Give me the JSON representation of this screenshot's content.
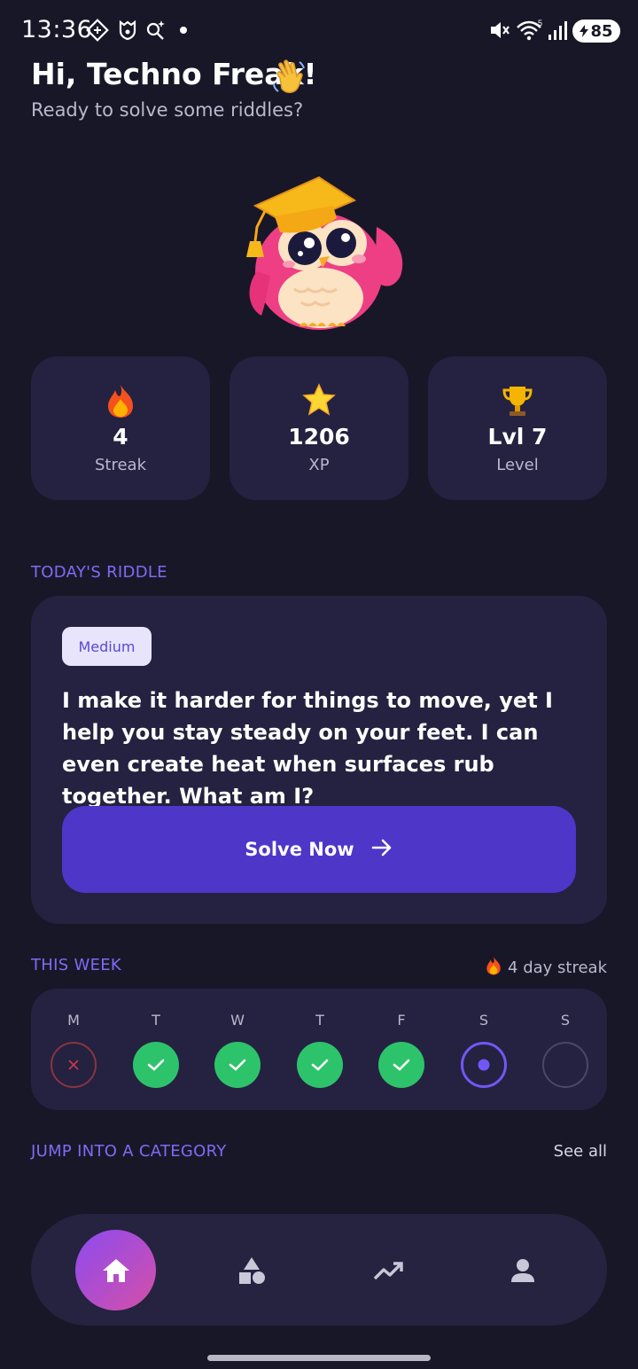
{
  "status_bar": {
    "time": "13:36",
    "battery": "85",
    "icons": [
      "gps-icon",
      "shield-icon",
      "search-sparkle-icon",
      "dot-icon",
      "mute-icon",
      "wifi-icon",
      "signal-icon",
      "battery-icon"
    ]
  },
  "header": {
    "greeting": "Hi, Techno Freak!",
    "subtitle": "Ready to solve some riddles?"
  },
  "stats": [
    {
      "icon": "fire-icon",
      "value": "4",
      "label": "Streak"
    },
    {
      "icon": "star-icon",
      "value": "1206",
      "label": "XP"
    },
    {
      "icon": "trophy-icon",
      "value": "Lvl 7",
      "label": "Level"
    }
  ],
  "riddle": {
    "section_title": "TODAY'S RIDDLE",
    "difficulty": "Medium",
    "text": "I make it harder for things to move, yet I help you stay steady on your feet. I can even create heat when surfaces rub together. What am I?",
    "button_label": "Solve Now"
  },
  "week": {
    "section_title": "THIS WEEK",
    "streak_text": "4 day streak",
    "days": [
      {
        "letter": "M",
        "status": "missed"
      },
      {
        "letter": "T",
        "status": "done"
      },
      {
        "letter": "W",
        "status": "done"
      },
      {
        "letter": "T",
        "status": "done"
      },
      {
        "letter": "F",
        "status": "done"
      },
      {
        "letter": "S",
        "status": "today"
      },
      {
        "letter": "S",
        "status": "future"
      }
    ]
  },
  "categories": {
    "section_title": "JUMP INTO A CATEGORY",
    "see_all": "See all"
  },
  "nav": {
    "items": [
      "home-icon",
      "categories-icon",
      "progress-icon",
      "profile-icon"
    ],
    "active": "home-icon"
  },
  "colors": {
    "background": "#181728",
    "card": "#242240",
    "accent": "#4e36c9",
    "section_label": "#7f6bf4",
    "success": "#2dc36b"
  }
}
